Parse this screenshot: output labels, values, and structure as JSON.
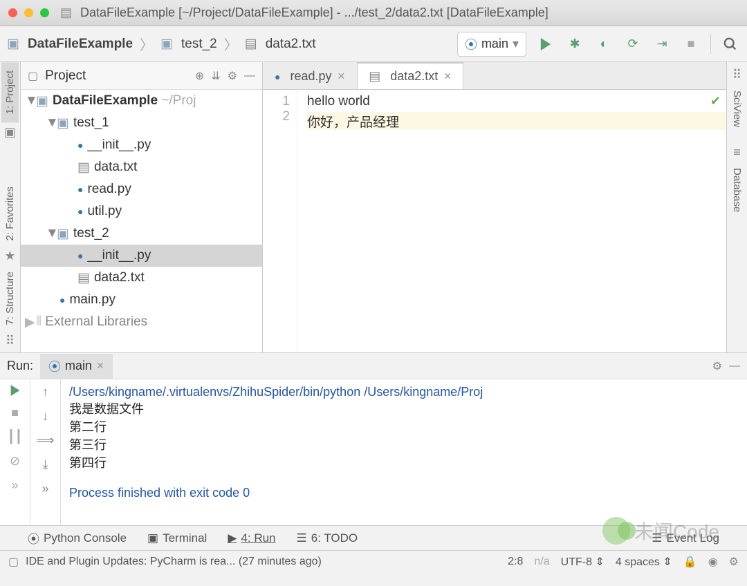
{
  "window": {
    "title": "DataFileExample [~/Project/DataFileExample] - .../test_2/data2.txt [DataFileExample]"
  },
  "breadcrumb": {
    "items": [
      "DataFileExample",
      "test_2",
      "data2.txt"
    ]
  },
  "runConfig": {
    "label": "main"
  },
  "projectPanel": {
    "title": "Project",
    "root": {
      "name": "DataFileExample",
      "path": "~/Proj"
    },
    "tree": {
      "test1": "test_1",
      "t1_init": "__init__.py",
      "t1_data": "data.txt",
      "t1_read": "read.py",
      "t1_util": "util.py",
      "test2": "test_2",
      "t2_init": "__init__.py",
      "t2_data": "data2.txt",
      "main": "main.py",
      "ext": "External Libraries"
    }
  },
  "editorTabs": [
    {
      "label": "read.py",
      "icon": "py"
    },
    {
      "label": "data2.txt",
      "icon": "txt"
    }
  ],
  "editor": {
    "lines": [
      "hello world",
      "你好，产品经理"
    ],
    "lineNums": [
      "1",
      "2"
    ]
  },
  "leftGutter": [
    "1: Project",
    "2: Favorites",
    "7: Structure"
  ],
  "rightGutter": [
    "SciView",
    "Database"
  ],
  "runPanel": {
    "title": "Run:",
    "tabLabel": "main",
    "consolePath": "/Users/kingname/.virtualenvs/ZhihuSpider/bin/python /Users/kingname/Proj",
    "out": [
      "我是数据文件",
      "第二行",
      "第三行",
      "第四行"
    ],
    "exit": "Process finished with exit code 0"
  },
  "bottomTabs": {
    "console": "Python Console",
    "terminal": "Terminal",
    "run": "4: Run",
    "todo": "6: TODO",
    "eventLog": "Event Log"
  },
  "status": {
    "msg": "IDE and Plugin Updates: PyCharm is rea... (27 minutes ago)",
    "pos": "2:8",
    "na": "n/a",
    "encoding": "UTF-8",
    "indent": "4 spaces"
  },
  "watermark": "未闻Code"
}
